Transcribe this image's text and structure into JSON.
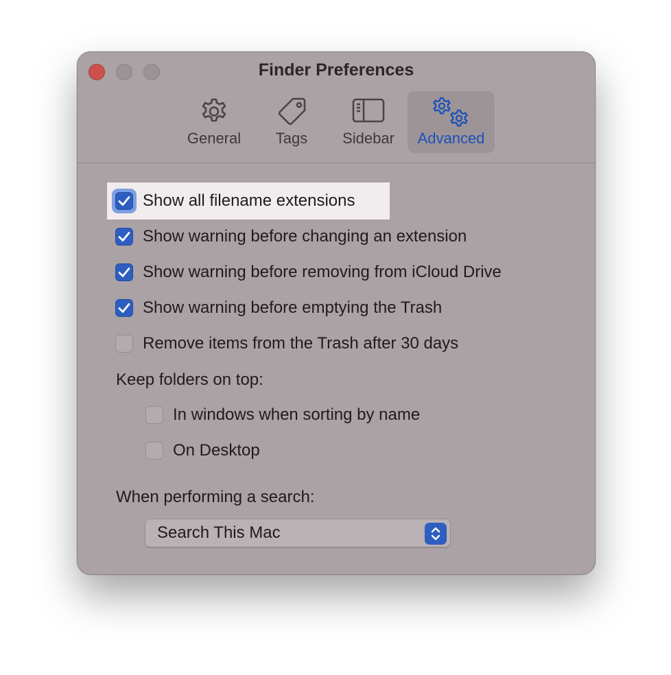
{
  "window": {
    "title": "Finder Preferences"
  },
  "tabs": [
    {
      "label": "General",
      "icon": "gear-icon",
      "active": false
    },
    {
      "label": "Tags",
      "icon": "tag-icon",
      "active": false
    },
    {
      "label": "Sidebar",
      "icon": "sidebar-icon",
      "active": false
    },
    {
      "label": "Advanced",
      "icon": "gears-icon",
      "active": true
    }
  ],
  "options": [
    {
      "label": "Show all filename extensions",
      "checked": true
    },
    {
      "label": "Show warning before changing an extension",
      "checked": true
    },
    {
      "label": "Show warning before removing from iCloud Drive",
      "checked": true
    },
    {
      "label": "Show warning before emptying the Trash",
      "checked": true
    },
    {
      "label": "Remove items from the Trash after 30 days",
      "checked": false
    }
  ],
  "keep_folders": {
    "heading": "Keep folders on top:",
    "options": [
      {
        "label": "In windows when sorting by name",
        "checked": false
      },
      {
        "label": "On Desktop",
        "checked": false
      }
    ]
  },
  "search": {
    "heading": "When performing a search:",
    "selected": "Search This Mac"
  },
  "colors": {
    "accent": "#2d5ec0",
    "close_button": "#c9524c",
    "window_bg": "#aba2a5"
  }
}
